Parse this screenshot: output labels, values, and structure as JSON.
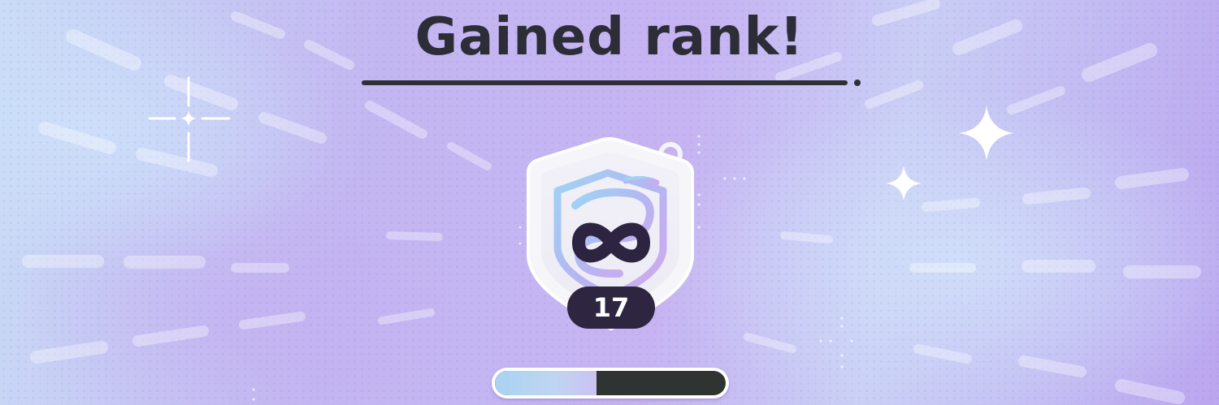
{
  "screen": {
    "title": "Gained rank!",
    "rank_icon": "infinity-icon",
    "rank_number": "17",
    "rank_progress": 0.44
  },
  "colors": {
    "title_text": "#2c2d36",
    "rank_pill": "#2e2541",
    "progress_fill": "#a9d3f1",
    "progress_track": "#2f3433"
  }
}
